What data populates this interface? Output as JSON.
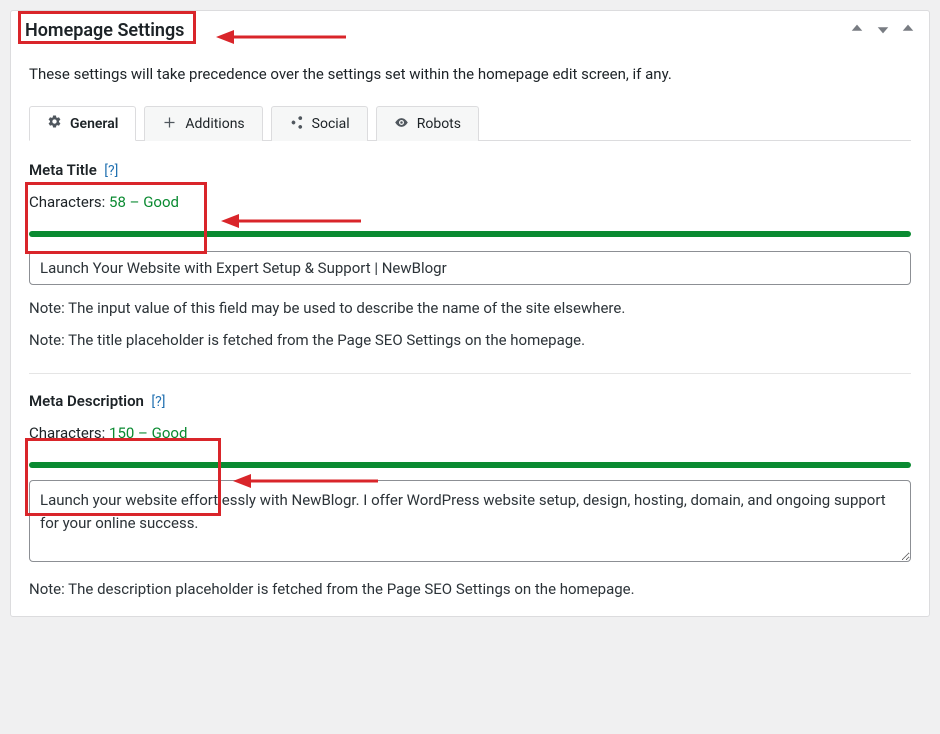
{
  "panel": {
    "title": "Homepage Settings",
    "description": "These settings will take precedence over the settings set within the homepage edit screen, if any."
  },
  "tabs": {
    "general": "General",
    "additions": "Additions",
    "social": "Social",
    "robots": "Robots"
  },
  "meta_title": {
    "label": "Meta Title",
    "help": "[?]",
    "char_prefix": "Characters: ",
    "char_count": "58",
    "char_separator": " – ",
    "char_status": "Good",
    "value": "Launch Your Website with Expert Setup & Support | NewBlogr",
    "note1": "Note: The input value of this field may be used to describe the name of the site elsewhere.",
    "note2": "Note: The title placeholder is fetched from the Page SEO Settings on the homepage."
  },
  "meta_description": {
    "label": "Meta Description",
    "help": "[?]",
    "char_prefix": "Characters: ",
    "char_count": "150",
    "char_separator": " – ",
    "char_status": "Good",
    "value": "Launch your website effortlessly with NewBlogr. I offer WordPress website setup, design, hosting, domain, and ongoing support for your online success.",
    "note1": "Note: The description placeholder is fetched from the Page SEO Settings on the homepage."
  }
}
